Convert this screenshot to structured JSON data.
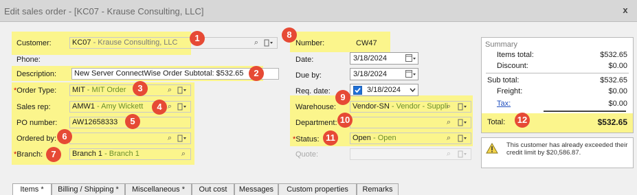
{
  "window": {
    "title": "Edit sales order - [KC07 - Krause Consulting, LLC]",
    "close_label": "x"
  },
  "labels": {
    "customer": "Customer:",
    "phone": "Phone:",
    "description": "Description:",
    "order_type": "Order Type:",
    "sales_rep": "Sales rep:",
    "po_number": "PO number:",
    "ordered_by": "Ordered by:",
    "branch": "Branch:",
    "number": "Number:",
    "date": "Date:",
    "due_by": "Due by:",
    "req_date": "Req. date:",
    "warehouse": "Warehouse:",
    "department": "Department:",
    "status": "Status:",
    "quote": "Quote:",
    "required_mark": "*"
  },
  "fields": {
    "customer_code": "KC07",
    "customer_name": " - Krause Consulting, LLC",
    "description": "New Server ConnectWise Order Subtotal: $532.65",
    "order_type_code": "MIT",
    "order_type_name": " - MIT Order",
    "sales_rep_code": "AMW1",
    "sales_rep_name": " - Amy Wickett",
    "po_number": "AW12658333",
    "ordered_by": "",
    "branch_code": "Branch 1",
    "branch_name": " - Branch 1",
    "number": "CW47",
    "date": "3/18/2024",
    "due_by": "3/18/2024",
    "req_date": "3/18/2024",
    "req_date_checked": true,
    "warehouse_code": "Vendor-SN",
    "warehouse_name": " - Vendor - Suppli",
    "department": "",
    "status_code": "Open",
    "status_name": " - Open",
    "quote": ""
  },
  "summary": {
    "title": "Summary",
    "items_total_label": "Items total:",
    "items_total": "$532.65",
    "discount_label": "Discount:",
    "discount": "$0.00",
    "sub_total_label": "Sub total:",
    "sub_total": "$532.65",
    "freight_label": "Freight:",
    "freight": "$0.00",
    "tax_label": "Tax:",
    "tax": "$0.00",
    "total_label": "Total:",
    "total": "$532.65"
  },
  "alert": {
    "text": "This customer has already exceeded their credit limit by $20,586.87."
  },
  "badges": [
    "1",
    "2",
    "3",
    "4",
    "5",
    "6",
    "7",
    "8",
    "9",
    "10",
    "11",
    "12"
  ],
  "tabs": [
    "Items *",
    "Billing / Shipping *",
    "Miscellaneous *",
    "Out cost",
    "Messages",
    "Custom properties",
    "Remarks"
  ],
  "colors": {
    "highlight": "#fbf58c",
    "badge": "#e64a35",
    "link": "#1f4fbf"
  }
}
